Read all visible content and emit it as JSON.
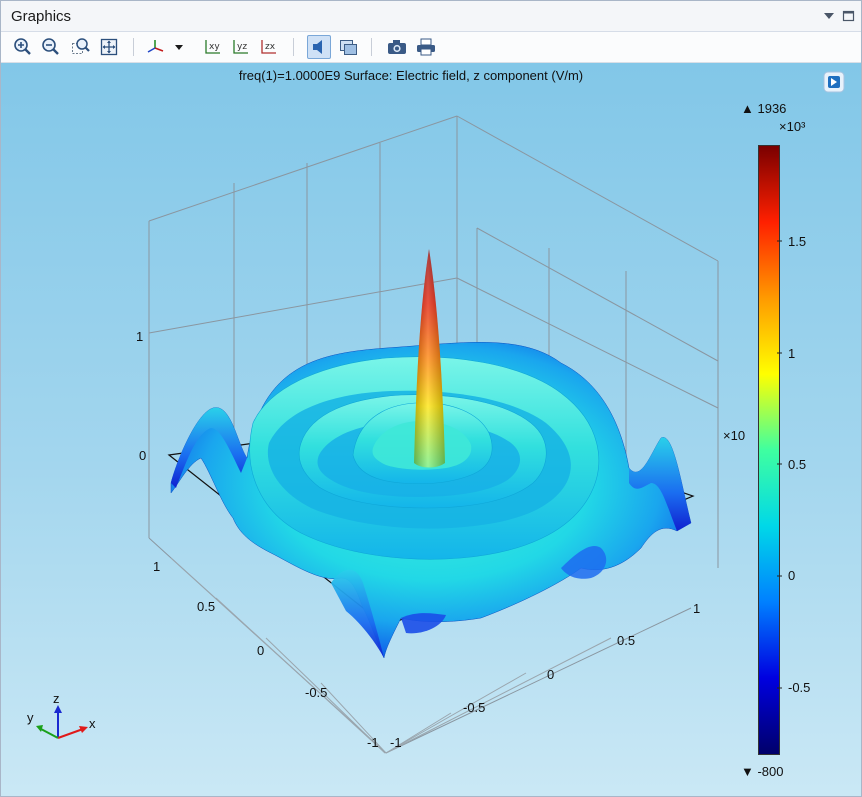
{
  "window": {
    "title": "Graphics"
  },
  "toolbar": {
    "buttons": [
      {
        "name": "zoom-in-icon"
      },
      {
        "name": "zoom-out-icon"
      },
      {
        "name": "zoom-box-icon"
      },
      {
        "name": "zoom-extents-icon"
      },
      {
        "name": "view-axes-icon"
      },
      {
        "name": "view-xy-label",
        "label": "xy"
      },
      {
        "name": "view-yz-label",
        "label": "yz"
      },
      {
        "name": "view-zx-label",
        "label": "zx"
      },
      {
        "name": "scene-light-icon"
      },
      {
        "name": "transparency-icon"
      },
      {
        "name": "image-snapshot-icon"
      },
      {
        "name": "print-icon"
      }
    ]
  },
  "plot": {
    "title": "freq(1)=1.0000E9   Surface: Electric field, z component (V/m)",
    "z_ticks": [
      "1",
      "0"
    ],
    "x_ticks": [
      "1",
      "0.5",
      "0",
      "-0.5",
      "-1"
    ],
    "y_ticks": [
      "1",
      "0.5",
      "0",
      "-0.5",
      "-1"
    ],
    "axis_triad": {
      "x": "x",
      "y": "y",
      "z": "z"
    },
    "side_multiplier": "×10"
  },
  "colorbar": {
    "max_label": "▲ 1936",
    "min_label": "▼ -800",
    "multiplier": "×10³",
    "ticks": [
      "1.5",
      "1",
      "0.5",
      "0",
      "-0.5"
    ],
    "colors": [
      "#7a0000",
      "#ff2000",
      "#ff9a00",
      "#ffff00",
      "#3fffa0",
      "#00d8e8",
      "#0080ff",
      "#0000e0",
      "#00006a"
    ]
  }
}
